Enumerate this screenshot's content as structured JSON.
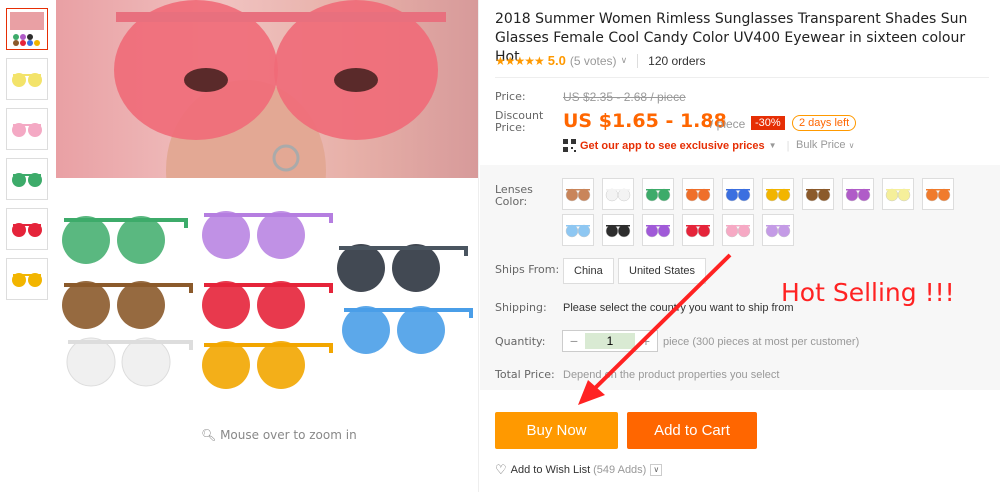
{
  "product": {
    "title": "2018 Summer Women Rimless Sunglasses Transparent Shades Sun Glasses Female Cool Candy Color UV400 Eyewear in sixteen colour Hot",
    "stars": "★★★★★",
    "score": "5.0",
    "votes": "(5 votes)",
    "orders": "120 orders"
  },
  "price": {
    "label": "Price:",
    "old": "US $2.35 - 2.68 / piece",
    "discount_label": "Discount Price:",
    "current": "US $1.65 - 1.88",
    "unit": "/ piece",
    "off": "-30%",
    "days_left": "2 days left",
    "app_promo": "Get our app to see exclusive prices",
    "bulk": "Bulk Price"
  },
  "lenses": {
    "label": "Lenses Color:",
    "colors": [
      "#c9855a",
      "#f3f3f3",
      "#3dab6a",
      "#ef6f2a",
      "#3b6fe0",
      "#f2b500",
      "#8b5a2b",
      "#b05cc8",
      "#f5ef9a",
      "#f07b2c",
      "#8ec7f2",
      "#2d2d2d",
      "#a05ad8",
      "#e5243a",
      "#f6a9c4",
      "#c49be6"
    ]
  },
  "ships": {
    "label": "Ships From:",
    "options": [
      "China",
      "United States"
    ]
  },
  "shipping": {
    "label": "Shipping:",
    "message": "Please select the country you want to ship from"
  },
  "quantity": {
    "label": "Quantity:",
    "value": "1",
    "minus": "−",
    "plus": "+",
    "info": "piece (300 pieces at most per customer)"
  },
  "total": {
    "label": "Total Price:",
    "message": "Depend on the product properties you select"
  },
  "buttons": {
    "buy": "Buy Now",
    "cart": "Add to Cart"
  },
  "wishlist": {
    "label": "Add to Wish List",
    "count": "(549 Adds)"
  },
  "gallery": {
    "zoom_hint": "Mouse over to zoom in"
  },
  "annotation": {
    "text": "Hot Selling !!!"
  },
  "thumbs": [
    "#e9a0a4",
    "#f3e36a",
    "#f4a9c4",
    "#3dab6a",
    "#e5243a",
    "#f2b500"
  ]
}
